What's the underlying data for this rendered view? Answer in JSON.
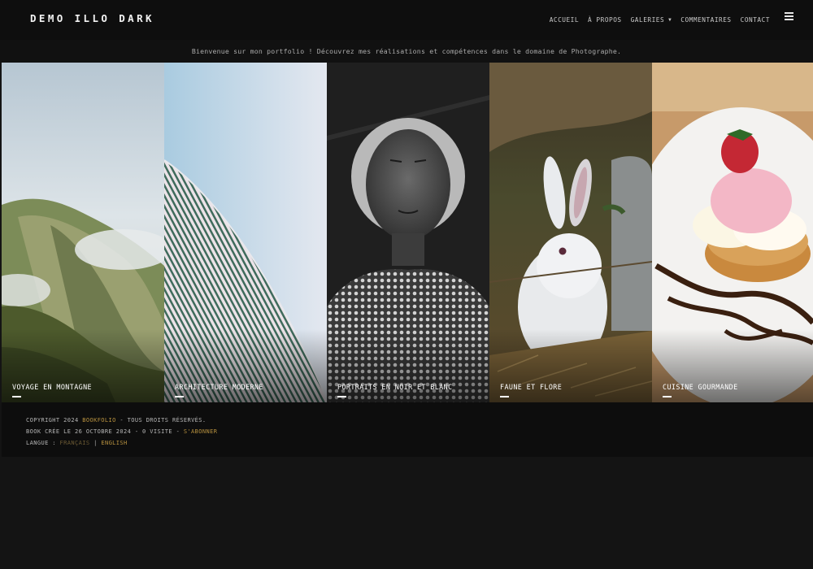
{
  "site": {
    "title": "DEMO ILLO DARK"
  },
  "nav": {
    "items": [
      {
        "label": "ACCUEIL"
      },
      {
        "label": "À PROPOS"
      },
      {
        "label": "GALERIES"
      },
      {
        "label": "COMMENTAIRES"
      },
      {
        "label": "CONTACT"
      }
    ],
    "menu_icon": "hamburger-icon"
  },
  "welcome": "Bienvenue sur mon portfolio ! Découvrez mes réalisations et compétences dans le domaine de Photographe.",
  "galleries": [
    {
      "caption": "VOYAGE EN MONTAGNE"
    },
    {
      "caption": "ARCHITECTURE MODERNE"
    },
    {
      "caption": "PORTRAITS EN NOIR ET BLANC"
    },
    {
      "caption": "FAUNE ET FLORE"
    },
    {
      "caption": "CUISINE GOURMANDE"
    }
  ],
  "footer": {
    "copyright_prefix": "COPYRIGHT 2024",
    "brand": "BOOKFOLIO",
    "rights": "- TOUS DROITS RÉSERVÉS.",
    "created": "BOOK CRÉE LE 26 OCTOBRE 2024 - 0 VISITE -",
    "subscribe": "S'ABONNER",
    "language_label": "LANGUE :",
    "lang_fr": "FRANÇAIS",
    "sep": "|",
    "lang_en": "ENGLISH"
  },
  "colors": {
    "background": "#141414",
    "accent": "#b8923f"
  }
}
